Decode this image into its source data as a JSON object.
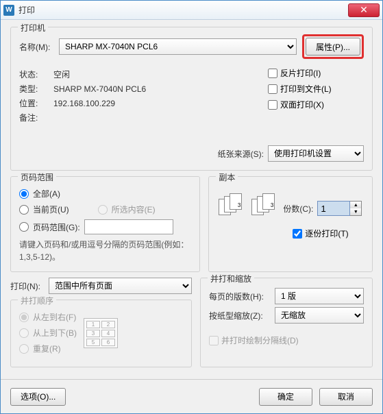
{
  "title": "打印",
  "printer_group": {
    "title": "打印机",
    "name_label": "名称(M):",
    "name_value": "SHARP MX-7040N PCL6",
    "properties_btn": "属性(P)...",
    "status_label": "状态:",
    "status_value": "空闲",
    "type_label": "类型:",
    "type_value": "SHARP MX-7040N PCL6",
    "where_label": "位置:",
    "where_value": "192.168.100.229",
    "comment_label": "备注:",
    "comment_value": "",
    "reverse_chk": "反片打印(I)",
    "tofile_chk": "打印到文件(L)",
    "duplex_chk": "双面打印(X)",
    "paper_label": "纸张来源(S):",
    "paper_value": "使用打印机设置"
  },
  "range_group": {
    "title": "页码范围",
    "all": "全部(A)",
    "current": "当前页(U)",
    "selection": "所选内容(E)",
    "pages": "页码范围(G):",
    "hint": "请键入页码和/或用逗号分隔的页码范围(例如：1,3,5-12)。"
  },
  "copies_group": {
    "title": "副本",
    "copies_label": "份数(C):",
    "copies_value": "1",
    "collate": "逐份打印(T)"
  },
  "print_label": "打印(N):",
  "print_value": "范围中所有页面",
  "order_group": {
    "title": "并打顺序",
    "lr": "从左到右(F)",
    "tb": "从上到下(B)",
    "repeat": "重复(R)"
  },
  "scale_group": {
    "title": "并打和缩放",
    "pps_label": "每页的版数(H):",
    "pps_value": "1 版",
    "scale_label": "按纸型缩放(Z):",
    "scale_value": "无缩放",
    "lines_chk": "并打时绘制分隔线(D)"
  },
  "footer": {
    "options": "选项(O)...",
    "ok": "确定",
    "cancel": "取消"
  }
}
